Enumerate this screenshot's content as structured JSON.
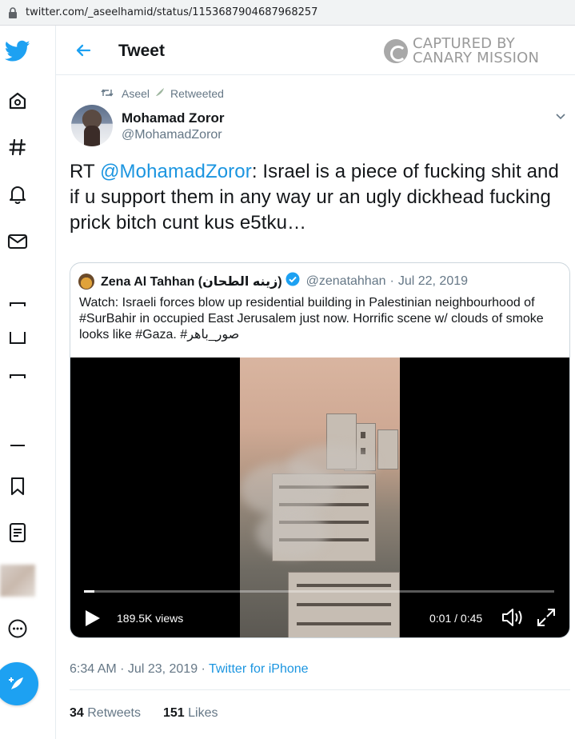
{
  "browser": {
    "url": "twitter.com/_aseelhamid/status/1153687904687968257"
  },
  "header": {
    "title": "Tweet",
    "watermark_line1": "CAPTURED BY",
    "watermark_line2": "CANARY MISSION"
  },
  "retweet": {
    "by": "Aseel",
    "label": "Retweeted"
  },
  "author": {
    "name": "Mohamad Zoror",
    "handle": "@MohamadZoror"
  },
  "tweet": {
    "prefix": "RT ",
    "mention": "@MohamadZoror",
    "body": ": Israel is a piece of fucking shit and if u support them in any way ur an ugly dickhead fucking prick bitch cunt kus e5tku…"
  },
  "quoted": {
    "name": "Zena Al Tahhan (زينه الطحان)",
    "handle": "@zenatahhan",
    "separator": "·",
    "date": "Jul 22, 2019",
    "text": "Watch: Israeli forces blow up residential building in Palestinian neighbourhood of #SurBahir in occupied East Jerusalem just now. Horrific scene w/ clouds of smoke looks like #Gaza. #صور_باهر",
    "video": {
      "views": "189.5K views",
      "time": "0:01 / 0:45",
      "progress": 0.022
    }
  },
  "meta": {
    "time": "6:34 AM · Jul 23, 2019 · ",
    "source": "Twitter for iPhone"
  },
  "stats": {
    "retweets_count": "34",
    "retweets_label": "Retweets",
    "likes_count": "151",
    "likes_label": "Likes"
  },
  "colors": {
    "accent": "#1da1f2",
    "link": "#1b95e0",
    "muted": "#657786"
  },
  "icons": [
    "twitter-bird-icon",
    "home-icon",
    "hashtag-icon",
    "bell-icon",
    "mail-icon",
    "bookmark-icon",
    "list-icon",
    "more-icon",
    "compose-icon",
    "back-arrow-icon",
    "retweet-icon",
    "chevron-down-icon",
    "verified-icon",
    "play-icon",
    "volume-icon",
    "fullscreen-icon",
    "lock-icon"
  ]
}
